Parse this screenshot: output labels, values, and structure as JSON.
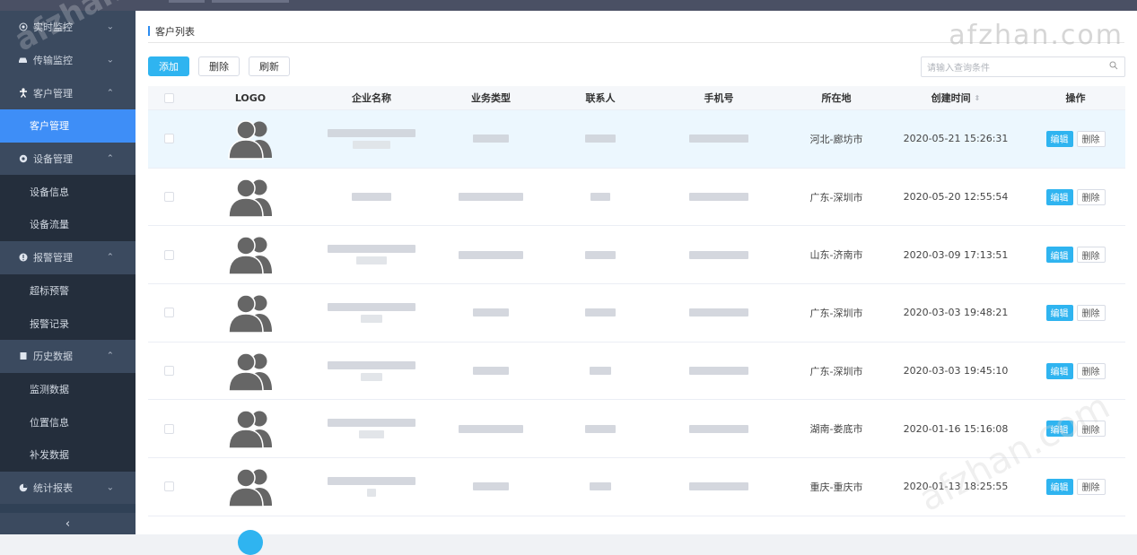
{
  "sidebar": {
    "groups": [
      {
        "label": "实时监控",
        "icon": "target-icon",
        "chevron": "⌄"
      },
      {
        "label": "传输监控",
        "icon": "car-icon",
        "chevron": "⌄"
      },
      {
        "label": "客户管理",
        "icon": "person-icon",
        "chevron": "⌃",
        "sub": [
          {
            "label": "客户管理",
            "active": true
          }
        ]
      },
      {
        "label": "设备管理",
        "icon": "gear-icon",
        "chevron": "⌃",
        "sub": [
          {
            "label": "设备信息"
          },
          {
            "label": "设备流量"
          }
        ]
      },
      {
        "label": "报警管理",
        "icon": "alert-icon",
        "chevron": "⌃",
        "sub": [
          {
            "label": "超标预警"
          },
          {
            "label": "报警记录"
          }
        ]
      },
      {
        "label": "历史数据",
        "icon": "book-icon",
        "chevron": "⌃",
        "sub": [
          {
            "label": "监测数据"
          },
          {
            "label": "位置信息"
          },
          {
            "label": "补发数据"
          }
        ]
      },
      {
        "label": "统计报表",
        "icon": "chart-icon",
        "chevron": "⌄"
      }
    ],
    "collapse": "‹"
  },
  "breadcrumb": "客户列表",
  "toolbar": {
    "add": "添加",
    "delete": "删除",
    "refresh": "刷新"
  },
  "search": {
    "placeholder": "请输入查询条件"
  },
  "table": {
    "headers": {
      "logo": "LOGO",
      "name": "企业名称",
      "type": "业务类型",
      "contact": "联系人",
      "phone": "手机号",
      "location": "所在地",
      "created": "创建时间",
      "ops": "操作"
    },
    "rows": [
      {
        "location": "河北-廊坊市",
        "created": "2020-05-21 15:26:31"
      },
      {
        "location": "广东-深圳市",
        "created": "2020-05-20 12:55:54"
      },
      {
        "location": "山东-济南市",
        "created": "2020-03-09 17:13:51"
      },
      {
        "location": "广东-深圳市",
        "created": "2020-03-03 19:48:21"
      },
      {
        "location": "广东-深圳市",
        "created": "2020-03-03 19:45:10"
      },
      {
        "location": "湖南-娄底市",
        "created": "2020-01-16 15:16:08"
      },
      {
        "location": "重庆-重庆市",
        "created": "2020-01-13 18:25:55"
      }
    ],
    "edit_label": "编辑",
    "delete_label": "删除"
  },
  "watermark": "afzhan.com",
  "colors": {
    "primary": "#2fb4f0",
    "sidebar": "#304156",
    "active": "#3e8ef7"
  }
}
